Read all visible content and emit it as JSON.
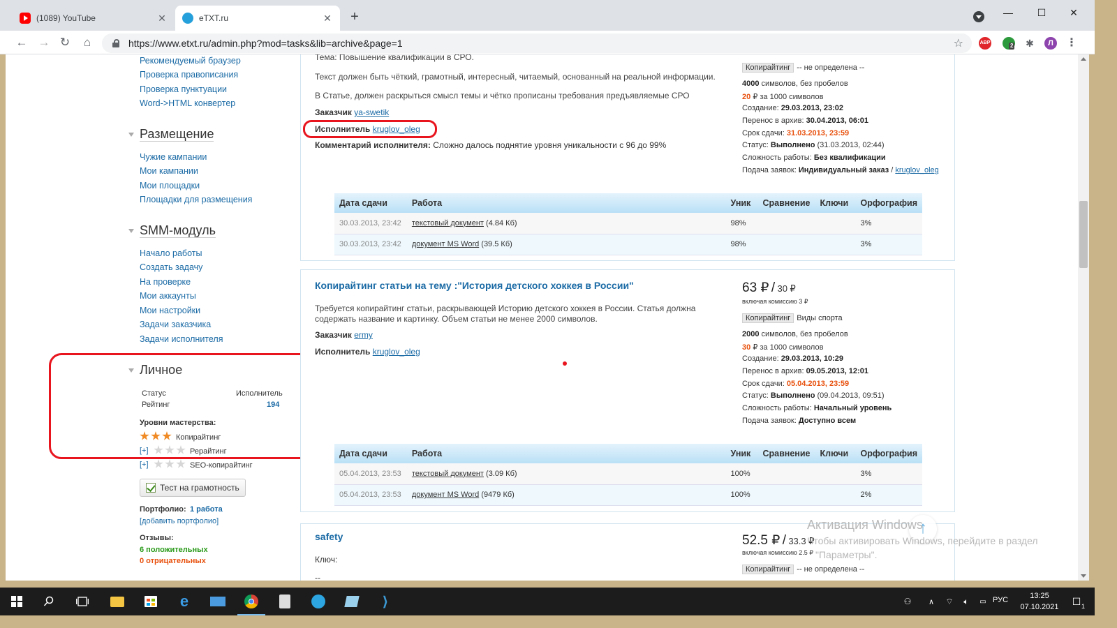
{
  "browser": {
    "tabs": [
      {
        "title": "(1089) YouTube",
        "active": false
      },
      {
        "title": "eTXT.ru",
        "active": true
      }
    ],
    "url": "https://www.etxt.ru/admin.php?mod=tasks&lib=archive&page=1",
    "profile_initial": "Л",
    "ext_badge": "2",
    "abp_label": "ABP"
  },
  "sidebar": {
    "tools_links": [
      "Рекомендуемый браузер",
      "Проверка правописания",
      "Проверка пунктуации",
      "Word->HTML конвертер"
    ],
    "placement": {
      "heading": "Размещение",
      "links": [
        "Чужие кампании",
        "Мои кампании",
        "Мои площадки",
        "Площадки для размещения"
      ]
    },
    "smm": {
      "heading": "SMM-модуль",
      "links": [
        "Начало работы",
        "Создать задачу",
        "На проверке",
        "Мои аккаунты",
        "Мои настройки",
        "Задачи заказчика",
        "Задачи исполнителя"
      ]
    },
    "personal": {
      "heading": "Личное",
      "status_label": "Статус",
      "status_value": "Исполнитель",
      "rating_label": "Рейтинг",
      "rating_value": "194",
      "levels_label": "Уровни мастерства:",
      "skills": [
        {
          "name": "Копирайтинг",
          "stars": 3,
          "plus": ""
        },
        {
          "name": "Рерайтинг",
          "stars": 0,
          "plus": "[+]"
        },
        {
          "name": "SEO-копирайтинг",
          "stars": 0,
          "plus": "[+]"
        }
      ],
      "grammar_button": "Тест на грамотность",
      "portfolio_label": "Портфолио:",
      "portfolio_value": "1 работа",
      "add_portfolio": "[добавить портфолио]",
      "reviews_label": "Отзывы:",
      "reviews_positive": "6 положительных",
      "reviews_negative": "0 отрицательных"
    }
  },
  "tasks": [
    {
      "theme_line": "Тема: Повышение квалификации в СРО.",
      "text1": "Текст должен быть чёткий, грамотный, интересный, читаемый, основанный на реальной информации.",
      "text2": "В Статье, должен раскрыться смысл темы и чётко прописаны требования предъявляемые СРО",
      "customer_label": "Заказчик",
      "customer": "ya-swetik",
      "performer_label": "Исполнитель",
      "performer": "kruglov_oleg",
      "comment_label": "Комментарий исполнителя:",
      "comment": "Сложно далось поднятие уровня уникальности с 96 до 99%",
      "category_tag": "Копирайтинг",
      "category": "-- не определена --",
      "chars_count": "4000",
      "chars_suffix": "символов, без пробелов",
      "rate": "20",
      "rate_suffix": "₽ за 1000 символов",
      "created_label": "Создание:",
      "created": "29.03.2013, 23:02",
      "archived_label": "Перенос в архив:",
      "archived": "30.04.2013, 06:01",
      "deadline_label": "Срок сдачи:",
      "deadline": "31.03.2013, 23:59",
      "status_label": "Статус:",
      "status": "Выполнено",
      "status_date": "(31.03.2013, 02:44)",
      "difficulty_label": "Сложность работы:",
      "difficulty": "Без квалификации",
      "apply_label": "Подача заявок:",
      "apply": "Индивидуальный заказ",
      "apply_sep": "/",
      "apply_user": "kruglov_oleg",
      "works": [
        {
          "date": "30.03.2013, 23:42",
          "doc": "текстовый документ",
          "size": "(4.84 Кб)",
          "unique": "98%",
          "spelling": "3%"
        },
        {
          "date": "30.03.2013, 23:42",
          "doc": "документ MS Word",
          "size": "(39.5 Кб)",
          "unique": "98%",
          "spelling": "3%"
        }
      ]
    },
    {
      "title": "Копирайтинг статьи на тему :\"История детского хоккея в России\"",
      "price": "63 ₽",
      "price_sep": "/",
      "price_net": "30 ₽",
      "price_note": "включая комиссию 3 ₽",
      "text1": "Требуется копирайтинг статьи, раскрывающей Историю детского хоккея в России. Статья должна содержать название и картинку. Объем статьи не менее 2000 символов.",
      "customer_label": "Заказчик",
      "customer": "ermy",
      "performer_label": "Исполнитель",
      "performer": "kruglov_oleg",
      "category_tag": "Копирайтинг",
      "category": "Виды спорта",
      "chars_count": "2000",
      "chars_suffix": "символов, без пробелов",
      "rate": "30",
      "rate_suffix": "₽ за 1000 символов",
      "created_label": "Создание:",
      "created": "29.03.2013, 10:29",
      "archived_label": "Перенос в архив:",
      "archived": "09.05.2013, 12:01",
      "deadline_label": "Срок сдачи:",
      "deadline": "05.04.2013, 23:59",
      "status_label": "Статус:",
      "status": "Выполнено",
      "status_date": "(09.04.2013, 09:51)",
      "difficulty_label": "Сложность работы:",
      "difficulty": "Начальный уровень",
      "apply_label": "Подача заявок:",
      "apply": "Доступно всем",
      "works": [
        {
          "date": "05.04.2013, 23:53",
          "doc": "текстовый документ",
          "size": "(3.09 Кб)",
          "unique": "100%",
          "spelling": "3%"
        },
        {
          "date": "05.04.2013, 23:53",
          "doc": "документ MS Word",
          "size": "(9479 Кб)",
          "unique": "100%",
          "spelling": "2%"
        }
      ]
    },
    {
      "title": "safety",
      "key_label": "Ключ:",
      "key_value": "--",
      "price": "52.5 ₽",
      "price_sep": "/",
      "price_net": "33.3 ₽",
      "price_note": "включая комиссию 2.5 ₽",
      "category_tag": "Копирайтинг",
      "category": "-- не определена --"
    }
  ],
  "table_headers": {
    "date": "Дата сдачи",
    "work": "Работа",
    "unique": "Уник",
    "compare": "Сравнение",
    "keys": "Ключи",
    "spelling": "Орфография"
  },
  "watermark": {
    "line1": "Активация Windows",
    "line2": "Чтобы активировать Windows, перейдите в раздел",
    "line3": "\"Параметры\"."
  },
  "taskbar": {
    "lang": "РУС",
    "time": "13:25",
    "date": "07.10.2021",
    "notifications": "1"
  },
  "colors": {
    "link": "#1a6aa5",
    "orange": "#e8500d",
    "positive": "#2a9a1a",
    "annotation": "#e8141e"
  }
}
